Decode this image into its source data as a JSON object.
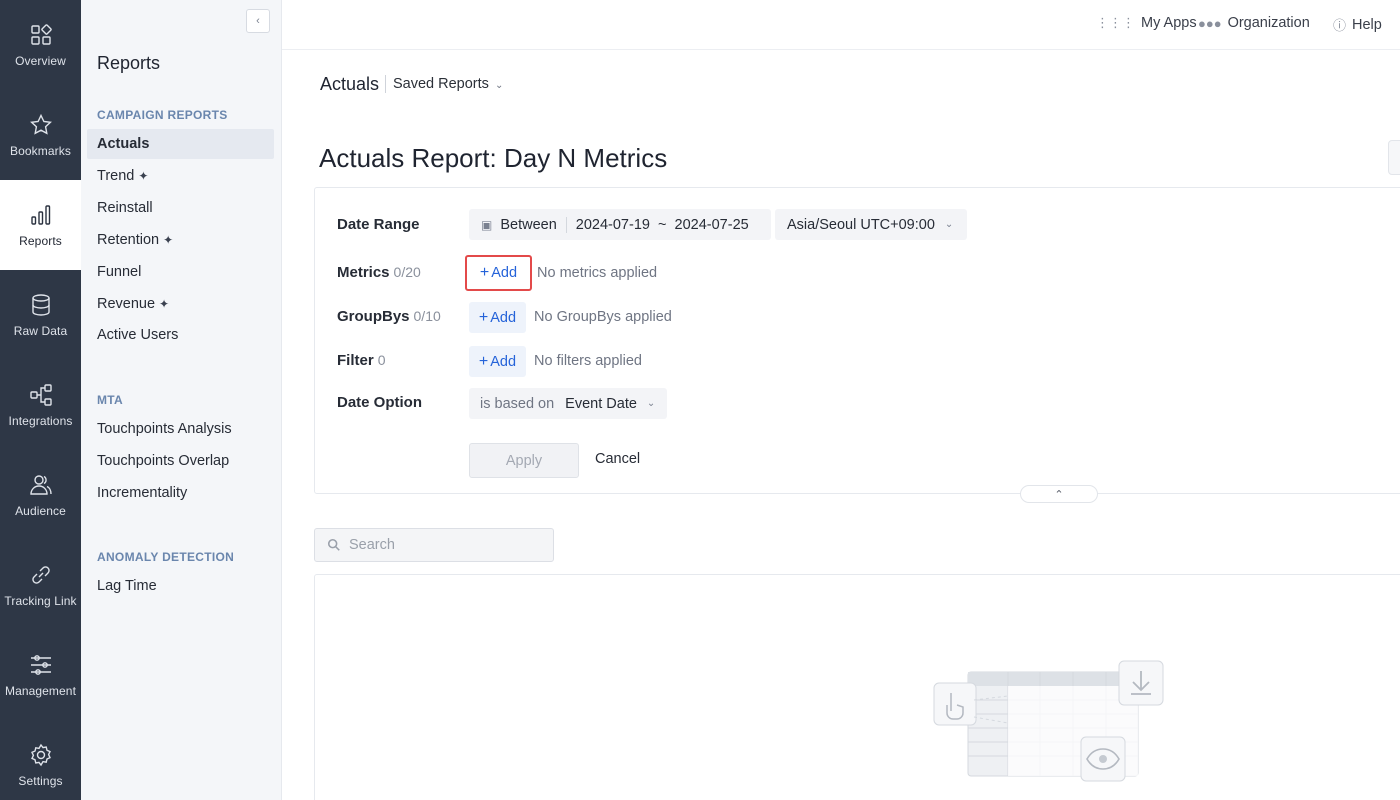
{
  "rail": {
    "items": [
      {
        "label": "Overview",
        "icon": "grid-icon"
      },
      {
        "label": "Bookmarks",
        "icon": "star-icon"
      },
      {
        "label": "Reports",
        "icon": "bar-chart-icon",
        "active": true
      },
      {
        "label": "Raw Data",
        "icon": "database-icon"
      },
      {
        "label": "Integrations",
        "icon": "network-icon"
      },
      {
        "label": "Audience",
        "icon": "users-icon"
      },
      {
        "label": "Tracking Link",
        "icon": "link-icon"
      },
      {
        "label": "Management",
        "icon": "sliders-icon"
      },
      {
        "label": "Settings",
        "icon": "gear-icon"
      }
    ]
  },
  "sidebar": {
    "title": "Reports",
    "sections": [
      {
        "title": "CAMPAIGN REPORTS",
        "items": [
          {
            "label": "Actuals",
            "active": true
          },
          {
            "label": "Trend",
            "sparkle": true
          },
          {
            "label": "Reinstall"
          },
          {
            "label": "Retention",
            "sparkle": true
          },
          {
            "label": "Funnel"
          },
          {
            "label": "Revenue",
            "sparkle": true
          },
          {
            "label": "Active Users"
          }
        ]
      },
      {
        "title": "MTA",
        "items": [
          {
            "label": "Touchpoints Analysis"
          },
          {
            "label": "Touchpoints Overlap"
          },
          {
            "label": "Incrementality"
          }
        ]
      },
      {
        "title": "ANOMALY DETECTION",
        "items": [
          {
            "label": "Lag Time"
          }
        ]
      }
    ]
  },
  "topbar": {
    "my_apps": "My Apps",
    "organization": "Organization",
    "help": "Help"
  },
  "breadcrumb": {
    "current": "Actuals",
    "saved_reports": "Saved Reports"
  },
  "page": {
    "title": "Actuals Report: Day N Metrics"
  },
  "filters": {
    "date_range": {
      "label": "Date Range",
      "mode": "Between",
      "value": "2024-07-19  ~  2024-07-25",
      "timezone": "Asia/Seoul UTC+09:00"
    },
    "metrics": {
      "label": "Metrics",
      "count": "0/20",
      "add": "Add",
      "empty": "No metrics applied"
    },
    "groupbys": {
      "label": "GroupBys",
      "count": "0/10",
      "add": "Add",
      "empty": "No GroupBys applied"
    },
    "filter": {
      "label": "Filter",
      "count": "0",
      "add": "Add",
      "empty": "No filters applied"
    },
    "date_option": {
      "label": "Date Option",
      "prefix": "is based on",
      "value": "Event Date"
    },
    "apply": "Apply",
    "cancel": "Cancel"
  },
  "search": {
    "placeholder": "Search"
  },
  "colors": {
    "rail_bg": "#2e3746",
    "accent": "#2563d9",
    "highlight": "#e34a4a"
  }
}
